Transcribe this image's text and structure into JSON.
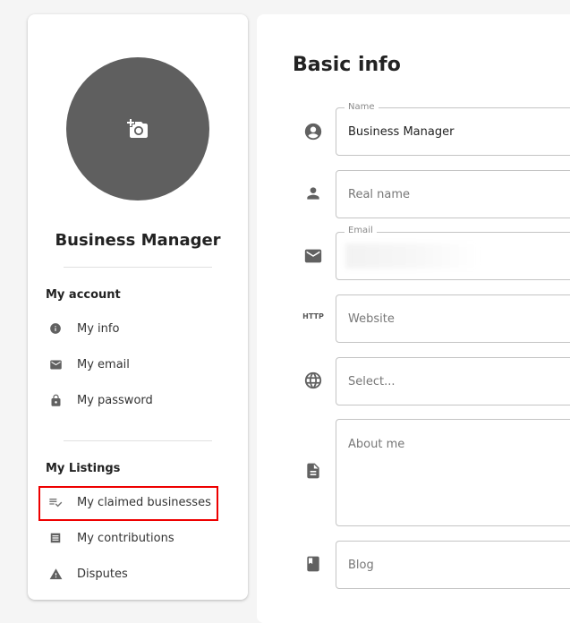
{
  "sidebar": {
    "user_name": "Business Manager",
    "account_heading": "My account",
    "account_items": [
      {
        "label": "My info",
        "icon": "info-icon"
      },
      {
        "label": "My email",
        "icon": "email-icon"
      },
      {
        "label": "My password",
        "icon": "lock-icon"
      }
    ],
    "listings_heading": "My Listings",
    "listing_items": [
      {
        "label": "My claimed businesses",
        "icon": "playlist-check-icon"
      },
      {
        "label": "My contributions",
        "icon": "list-icon"
      },
      {
        "label": "Disputes",
        "icon": "warning-icon"
      }
    ]
  },
  "main": {
    "title": "Basic info",
    "fields": {
      "name": {
        "label": "Name",
        "value": "Business Manager"
      },
      "real_name": {
        "placeholder": "Real name"
      },
      "email": {
        "label": "Email"
      },
      "website": {
        "placeholder": "Website",
        "icon_text": "HTTP"
      },
      "country": {
        "placeholder": "Select..."
      },
      "about": {
        "placeholder": "About me"
      },
      "blog": {
        "placeholder": "Blog"
      }
    }
  },
  "colors": {
    "highlight": "#ee0000",
    "avatar_bg": "#5f5f5f",
    "icon": "#616161"
  }
}
